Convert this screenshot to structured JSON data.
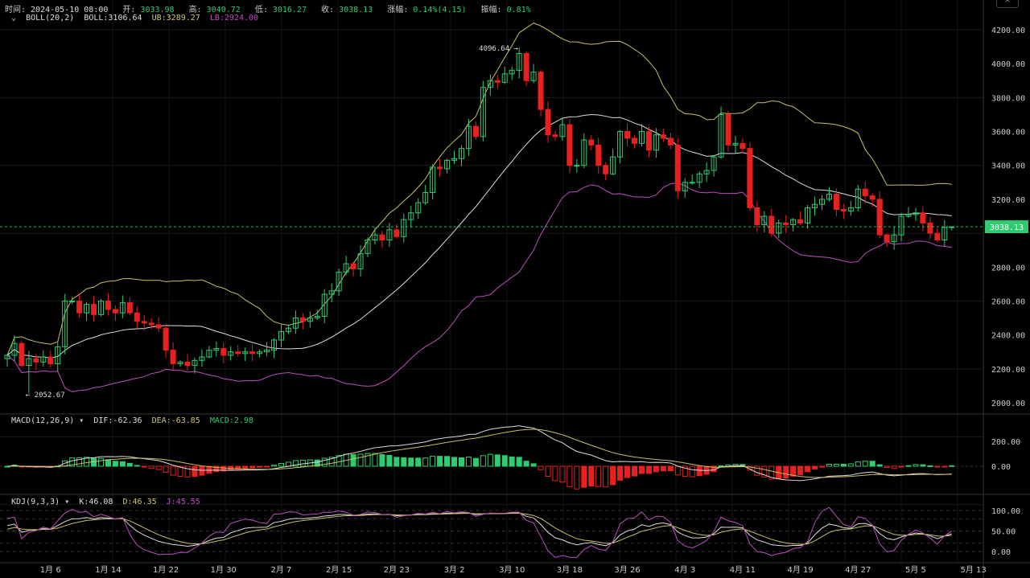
{
  "header": {
    "time_label": "时间:",
    "time": "2024-05-10 08:00",
    "open_label": "开:",
    "open": "3033.98",
    "high_label": "高:",
    "high": "3040.72",
    "low_label": "低:",
    "low": "3016.27",
    "close_label": "收:",
    "close": "3038.13",
    "change_label": "涨幅:",
    "change": "0.14%(4.15)",
    "amp_label": "振幅:",
    "amp": "0.81%"
  },
  "boll": {
    "name": "BOLL(20,2)",
    "mid": "BOLL:3106.64",
    "ub": "UB:3289.27",
    "lb": "LB:2924.00"
  },
  "macd": {
    "name": "MACD(12,26,9)",
    "dif": "DIF:-62.36",
    "dea": "DEA:-63.85",
    "macd": "MACD:2.98"
  },
  "kdj": {
    "name": "KDJ(9,3,3)",
    "k": "K:46.08",
    "d": "D:46.35",
    "j": "J:45.55"
  },
  "colors": {
    "up": "#2ecc71",
    "down": "#e8201e",
    "mid": "#dddddd",
    "ub": "#c8c060",
    "lb": "#c04cc0",
    "dea": "#c8c060",
    "j": "#c04cc0",
    "bg": "#000000"
  },
  "chart_data": {
    "type": "candlestick",
    "start_date": "2023-12-31",
    "closes": [
      2280,
      2350,
      2220,
      2260,
      2240,
      2270,
      2230,
      2330,
      2600,
      2600,
      2530,
      2580,
      2520,
      2600,
      2550,
      2530,
      2590,
      2530,
      2480,
      2470,
      2460,
      2440,
      2310,
      2230,
      2240,
      2220,
      2250,
      2270,
      2310,
      2320,
      2280,
      2300,
      2290,
      2300,
      2290,
      2300,
      2310,
      2370,
      2420,
      2440,
      2500,
      2480,
      2500,
      2510,
      2640,
      2660,
      2770,
      2820,
      2790,
      2880,
      2960,
      2990,
      2960,
      3020,
      2980,
      3080,
      3120,
      3180,
      3240,
      3390,
      3380,
      3430,
      3440,
      3500,
      3630,
      3570,
      3860,
      3900,
      3890,
      3940,
      3960,
      4060,
      3900,
      3950,
      3730,
      3580,
      3570,
      3640,
      3400,
      3400,
      3550,
      3520,
      3400,
      3350,
      3450,
      3600,
      3560,
      3530,
      3600,
      3490,
      3580,
      3560,
      3520,
      3250,
      3300,
      3300,
      3350,
      3370,
      3450,
      3700,
      3520,
      3530,
      3500,
      3150,
      3050,
      3100,
      3000,
      3060,
      3050,
      3080,
      3060,
      3150,
      3170,
      3200,
      3230,
      3140,
      3130,
      3150,
      3260,
      3220,
      3200,
      2990,
      2950,
      2990,
      3100,
      3110,
      3120,
      3060,
      3000,
      2960,
      3033.98,
      3038.13
    ],
    "annotations": [
      {
        "text": "4096.64 →",
        "index": 71,
        "value": 4096.64
      },
      {
        "text": "← 2052.67",
        "index": 3,
        "value": 2052.67
      }
    ],
    "last_price": "3038.13",
    "y_ticks": [
      "4200.00",
      "4000.00",
      "3800.00",
      "3600.00",
      "3400.00",
      "3200.00",
      "3000.00",
      "2800.00",
      "2600.00",
      "2400.00",
      "2200.00",
      "2000.00"
    ],
    "y_range": [
      2000,
      4200
    ],
    "macd_ticks": [
      "200.00",
      "0.00"
    ],
    "kdj_ticks": [
      "100.00",
      "50.00",
      "0.00"
    ],
    "x_ticks": [
      {
        "label": "1月 6",
        "index": 6
      },
      {
        "label": "1月 14",
        "index": 14
      },
      {
        "label": "1月 22",
        "index": 22
      },
      {
        "label": "1月 30",
        "index": 30
      },
      {
        "label": "2月 7",
        "index": 38
      },
      {
        "label": "2月 15",
        "index": 46
      },
      {
        "label": "2月 23",
        "index": 54
      },
      {
        "label": "3月 2",
        "index": 62
      },
      {
        "label": "3月 10",
        "index": 70
      },
      {
        "label": "3月 18",
        "index": 78
      },
      {
        "label": "3月 26",
        "index": 86
      },
      {
        "label": "4月 3",
        "index": 94
      },
      {
        "label": "4月 11",
        "index": 102
      },
      {
        "label": "4月 19",
        "index": 110
      },
      {
        "label": "4月 27",
        "index": 118
      },
      {
        "label": "5月 5",
        "index": 126
      },
      {
        "label": "5月 13",
        "index": 134
      }
    ]
  }
}
